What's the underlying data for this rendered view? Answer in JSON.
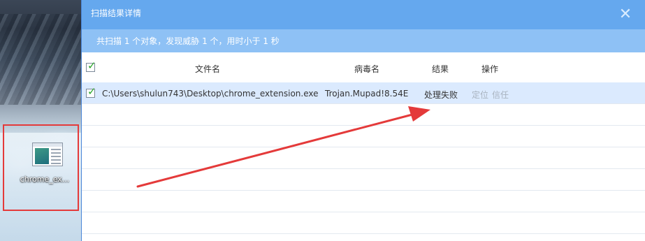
{
  "desktop": {
    "file_label": "chrome_ex..."
  },
  "dialog": {
    "title": "扫描结果详情",
    "summary": "共扫描 1 个对象，发现威胁 1 个，用时小于 1 秒",
    "columns": {
      "filename": "文件名",
      "virus_name": "病毒名",
      "result": "结果",
      "action": "操作"
    },
    "rows": [
      {
        "path": "C:\\Users\\shulun743\\Desktop\\chrome_extension.exe",
        "virus": "Trojan.Mupad!8.54E",
        "result": "处理失败",
        "locate": "定位",
        "trust": "信任"
      }
    ]
  },
  "colors": {
    "titlebar": "#65a8ee",
    "summary_bar": "#8ec1f5",
    "selected_row": "#dbeafe",
    "annotation": "#e43a3a"
  }
}
